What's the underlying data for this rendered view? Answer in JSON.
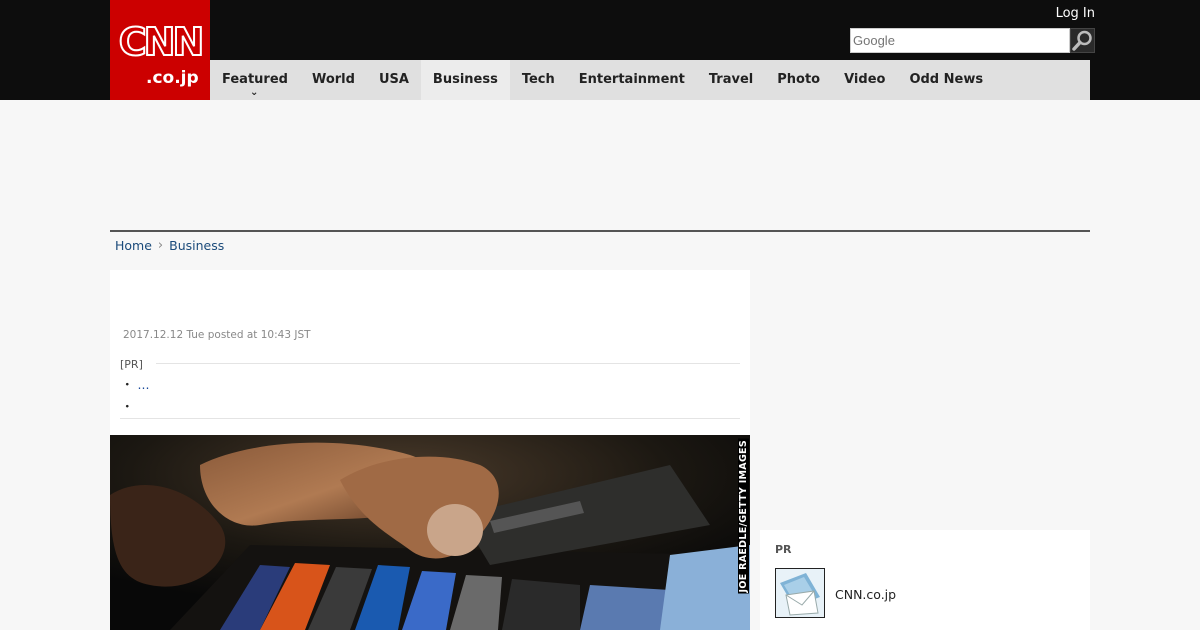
{
  "header": {
    "logo_text": "CNN",
    "logo_suffix": ".co.jp",
    "login_label": "Log In",
    "search_placeholder": "Google",
    "icons": {
      "search": "magnifier-icon",
      "caret": "chevron-down-icon"
    }
  },
  "nav": {
    "items": [
      {
        "label": "Featured",
        "has_caret": true
      },
      {
        "label": "World"
      },
      {
        "label": "USA"
      },
      {
        "label": "Business",
        "active": true
      },
      {
        "label": "Tech"
      },
      {
        "label": "Entertainment"
      },
      {
        "label": "Travel"
      },
      {
        "label": "Photo"
      },
      {
        "label": "Video"
      },
      {
        "label": "Odd News"
      }
    ]
  },
  "breadcrumb": {
    "home": "Home",
    "separator": "›",
    "current": "Business"
  },
  "article": {
    "date": "2017.12.12 Tue posted at 10:43 JST",
    "pr_label": "[PR]",
    "pr_items": [
      {
        "bullet": "・",
        "link": "..."
      },
      {
        "bullet": "・",
        "link": ""
      }
    ],
    "photo_credit": "JOE RAEDLE/GETTY IMAGES"
  },
  "sidebar": {
    "pr_label": "PR",
    "pr_item_name": "CNN.co.jp"
  },
  "colors": {
    "brand_red": "#cc0000",
    "header_bg": "#0d0d0d",
    "nav_bg": "#e0e0e0",
    "link": "#1a4a7a"
  }
}
